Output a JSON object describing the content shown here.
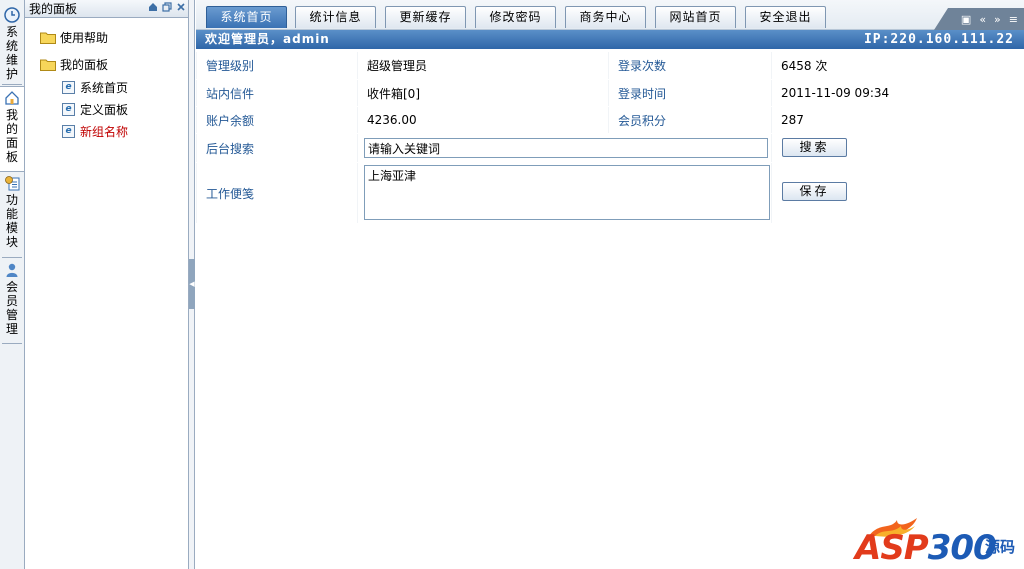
{
  "vtabs": [
    {
      "label": "系统维护",
      "icon": "clock-icon"
    },
    {
      "label": "我的面板",
      "icon": "home-icon"
    },
    {
      "label": "功能模块",
      "icon": "gear-document-icon"
    },
    {
      "label": "会员管理",
      "icon": "user-icon"
    }
  ],
  "tree": {
    "title": "我的面板",
    "nodes": [
      {
        "label": "使用帮助",
        "type": "folder"
      },
      {
        "label": "我的面板",
        "type": "folder"
      },
      {
        "label": "系统首页",
        "type": "page"
      },
      {
        "label": "定义面板",
        "type": "page"
      },
      {
        "label": "新组名称",
        "type": "page",
        "highlight": "#c00000"
      }
    ]
  },
  "tabs": [
    {
      "label": "系统首页",
      "active": true
    },
    {
      "label": "统计信息"
    },
    {
      "label": "更新缓存"
    },
    {
      "label": "修改密码"
    },
    {
      "label": "商务中心"
    },
    {
      "label": "网站首页"
    },
    {
      "label": "安全退出"
    }
  ],
  "welcome": {
    "text": "欢迎管理员，admin",
    "ip": "IP:220.160.111.22"
  },
  "info": {
    "admin_level_label": "管理级别",
    "admin_level_value": "超级管理员",
    "login_count_label": "登录次数",
    "login_count_value": "6458 次",
    "inbox_label": "站内信件",
    "inbox_value": "收件箱[0]",
    "login_time_label": "登录时间",
    "login_time_value": "2011-11-09 09:34",
    "balance_label": "账户余额",
    "balance_value": "4236.00",
    "points_label": "会员积分",
    "points_value": "287",
    "search_label": "后台搜索",
    "search_value": "请输入关键词",
    "search_button": "搜索",
    "notes_label": "工作便笺",
    "notes_value": "上海亚津",
    "save_button": "保存"
  },
  "logo": {
    "text_a": "ASP",
    "text_b": "300",
    "text_cn": "源码"
  },
  "colors": {
    "accent": "#3a72b4",
    "label": "#245996",
    "highlight": "#c00000"
  }
}
